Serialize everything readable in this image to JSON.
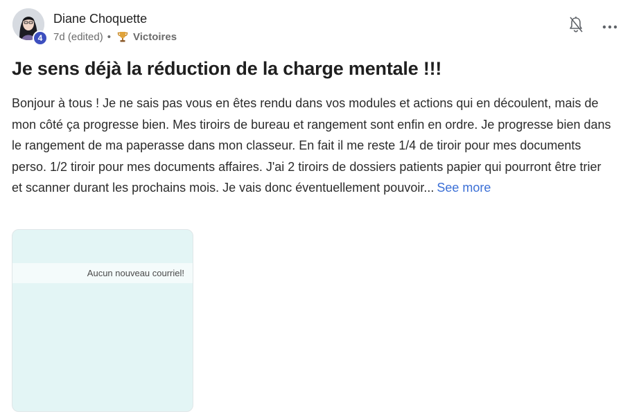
{
  "author": {
    "name": "Diane Choquette",
    "level": "4"
  },
  "meta": {
    "time": "7d (edited)",
    "separator": "•",
    "category": "Victoires",
    "category_icon": "trophy-icon"
  },
  "actions": {
    "bell_icon": "bell-icon",
    "more_icon": "more-options-icon"
  },
  "post": {
    "title": "Je sens déjà la réduction de la charge mentale !!!",
    "body": "Bonjour à tous ! Je ne sais pas vous en êtes rendu dans vos modules et actions qui en découlent, mais de mon côté ça progresse bien. Mes tiroirs de bureau et rangement sont enfin en ordre. Je progresse bien dans le rangement de ma paperasse dans mon classeur. En fait il me reste 1/4 de tiroir pour mes documents perso. 1/2 tiroir pour mes documents affaires. J'ai 2 tiroirs de dossiers patients papier qui pourront être trier et scanner durant les prochains mois. Je vais donc éventuellement pouvoir...",
    "see_more": "See more"
  },
  "attachment": {
    "mail_text": "Aucun nouveau courriel!"
  },
  "colors": {
    "accent_link": "#3b6fd6",
    "badge": "#3d4fbf",
    "attachment_bg": "#e3f5f5"
  }
}
